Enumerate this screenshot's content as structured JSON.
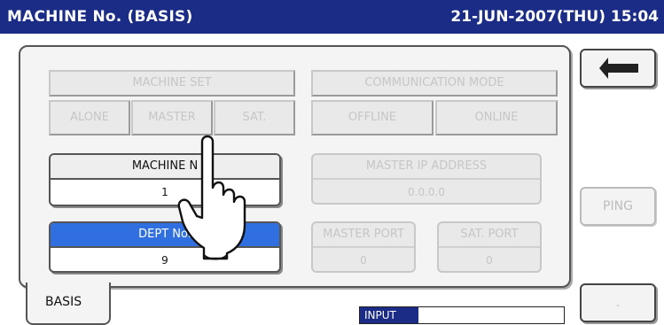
{
  "title": "MACHINE No. (BASIS)",
  "datetime": "21-JUN-2007(THU) 15:04",
  "machine_set": {
    "label": "MACHINE SET",
    "options": [
      "ALONE",
      "MASTER",
      "SAT."
    ]
  },
  "communication_mode": {
    "label": "COMMUNICATION MODE",
    "options": [
      "OFFLINE",
      "ONLINE"
    ]
  },
  "machine_no": {
    "label": "MACHINE N",
    "value": "1"
  },
  "master_ip": {
    "label": "MASTER IP ADDRESS",
    "value": "0.0.0.0"
  },
  "dept_no": {
    "label": "DEPT No.",
    "value": "9"
  },
  "master_port": {
    "label": "MASTER PORT",
    "value": "0"
  },
  "sat_port": {
    "label": "SAT. PORT",
    "value": "0"
  },
  "side": {
    "ping": "PING",
    "blank": "."
  },
  "tab": "BASIS",
  "input_label": "INPUT",
  "colors": {
    "titlebar": "#1a2c86",
    "selected_field": "#2f6fe0"
  }
}
